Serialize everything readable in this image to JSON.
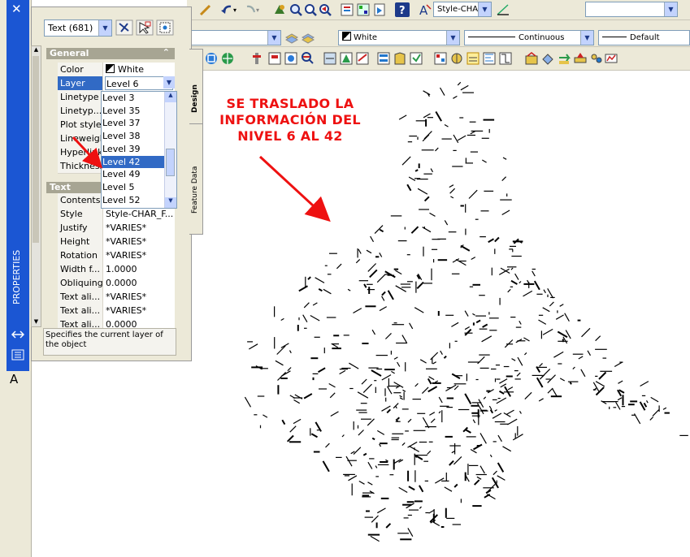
{
  "toolbar": {
    "row1_style_dropdown": "Style-CHAR_FA",
    "row2_color_dropdown": "White",
    "row2_linetype_dropdown": "Continuous",
    "row2_lineweight_dropdown": "Default"
  },
  "sidebar": {
    "close_glyph": "✕",
    "title": "PROPERTIES",
    "letter_a": "A"
  },
  "palette": {
    "selection_label": "Text (681)",
    "tabs": {
      "design": "Design",
      "feature_data": "Feature Data"
    },
    "sections": {
      "general": "General",
      "text": "Text"
    },
    "general_rows": [
      {
        "name": "Color",
        "value": "White"
      },
      {
        "name": "Layer",
        "value": "Level 6"
      },
      {
        "name": "Linetype",
        "value": ""
      },
      {
        "name": "Linetyp...",
        "value": ""
      },
      {
        "name": "Plot style",
        "value": ""
      },
      {
        "name": "Lineweight",
        "value": ""
      },
      {
        "name": "Hyperlink",
        "value": ""
      },
      {
        "name": "Thickness",
        "value": ""
      }
    ],
    "layer_dropdown_options": [
      "Level 3",
      "Level 35",
      "Level 37",
      "Level 38",
      "Level 39",
      "Level 42",
      "Level 49",
      "Level 5",
      "Level 52"
    ],
    "layer_dropdown_highlighted": "Level 42",
    "text_rows": [
      {
        "name": "Contents",
        "value": ""
      },
      {
        "name": "Style",
        "value": "Style-CHAR_F..."
      },
      {
        "name": "Justify",
        "value": "*VARIES*"
      },
      {
        "name": "Height",
        "value": "*VARIES*"
      },
      {
        "name": "Rotation",
        "value": "*VARIES*"
      },
      {
        "name": "Width f...",
        "value": "1.0000"
      },
      {
        "name": "Obliquing",
        "value": "0.0000"
      },
      {
        "name": "Text ali...",
        "value": "*VARIES*"
      },
      {
        "name": "Text ali...",
        "value": "*VARIES*"
      },
      {
        "name": "Text ali...",
        "value": "0.0000"
      }
    ],
    "description": "Specifies the current layer of the object"
  },
  "annotation": {
    "line1": "SE TRASLADO LA",
    "line2": "INFORMACIÓN DEL",
    "line3": "NIVEL 6 AL 42",
    "color": "#ee1111"
  },
  "colors": {
    "sidebar_blue": "#1b56d3",
    "selection_blue": "#316ac5"
  }
}
